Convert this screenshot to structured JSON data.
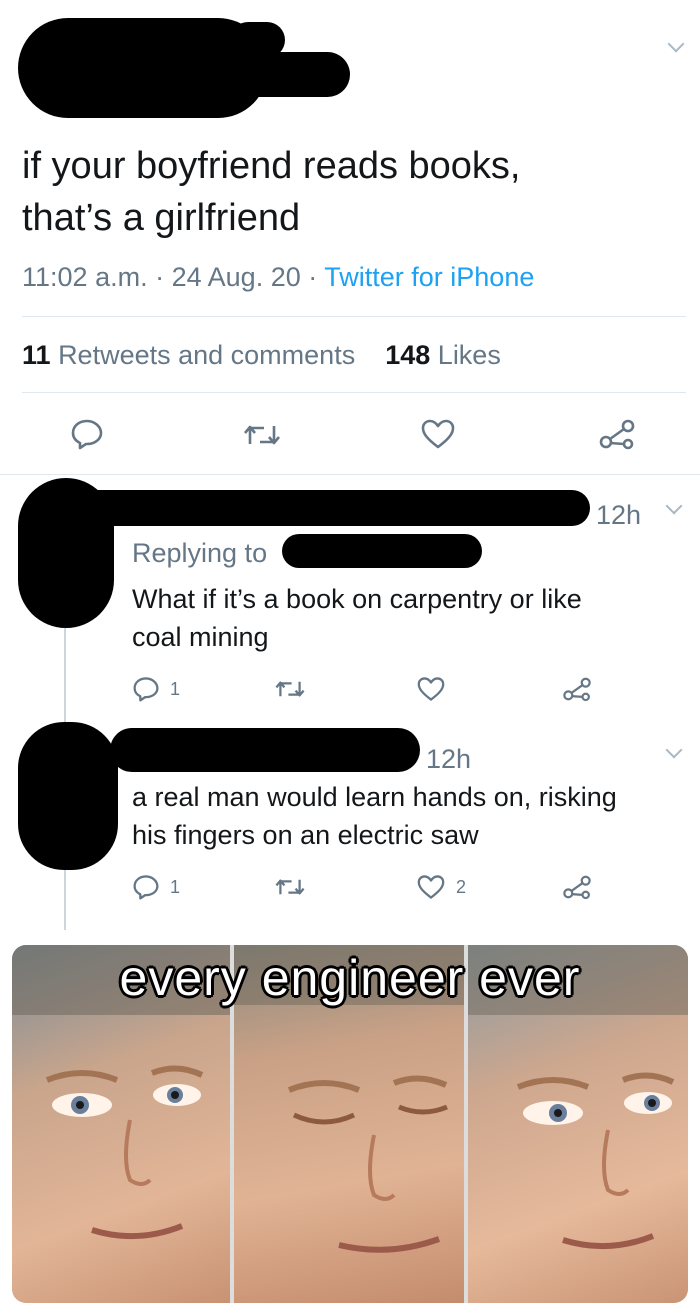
{
  "tweet": {
    "text_line1": "if your boyfriend reads books,",
    "text_line2": "that’s a girlfriend",
    "time": "11:02 a.m.",
    "dot": "·",
    "date": "24 Aug. 20",
    "source": "Twitter for iPhone",
    "retweets_count": "11",
    "retweets_label": "Retweets and comments",
    "likes_count": "148",
    "likes_label": "Likes"
  },
  "reply1": {
    "time": "12h",
    "replying_to": "Replying to",
    "text_line1": "What if it’s a book on carpentry or like",
    "text_line2": "coal mining",
    "reply_count": "1"
  },
  "reply2": {
    "time": "12h",
    "text_line1": "a real man would learn hands on, risking",
    "text_line2": "his fingers on an electric saw",
    "reply_count": "1",
    "like_count": "2"
  },
  "meme": {
    "caption": "every engineer ever"
  },
  "icons": {
    "reply": "speech-bubble-icon",
    "retweet": "retweet-icon",
    "like": "heart-icon",
    "share": "share-icon",
    "more": "chevron-down-icon"
  },
  "colors": {
    "link": "#1da1f2",
    "muted": "#657786",
    "divider": "#e1e8ed"
  }
}
